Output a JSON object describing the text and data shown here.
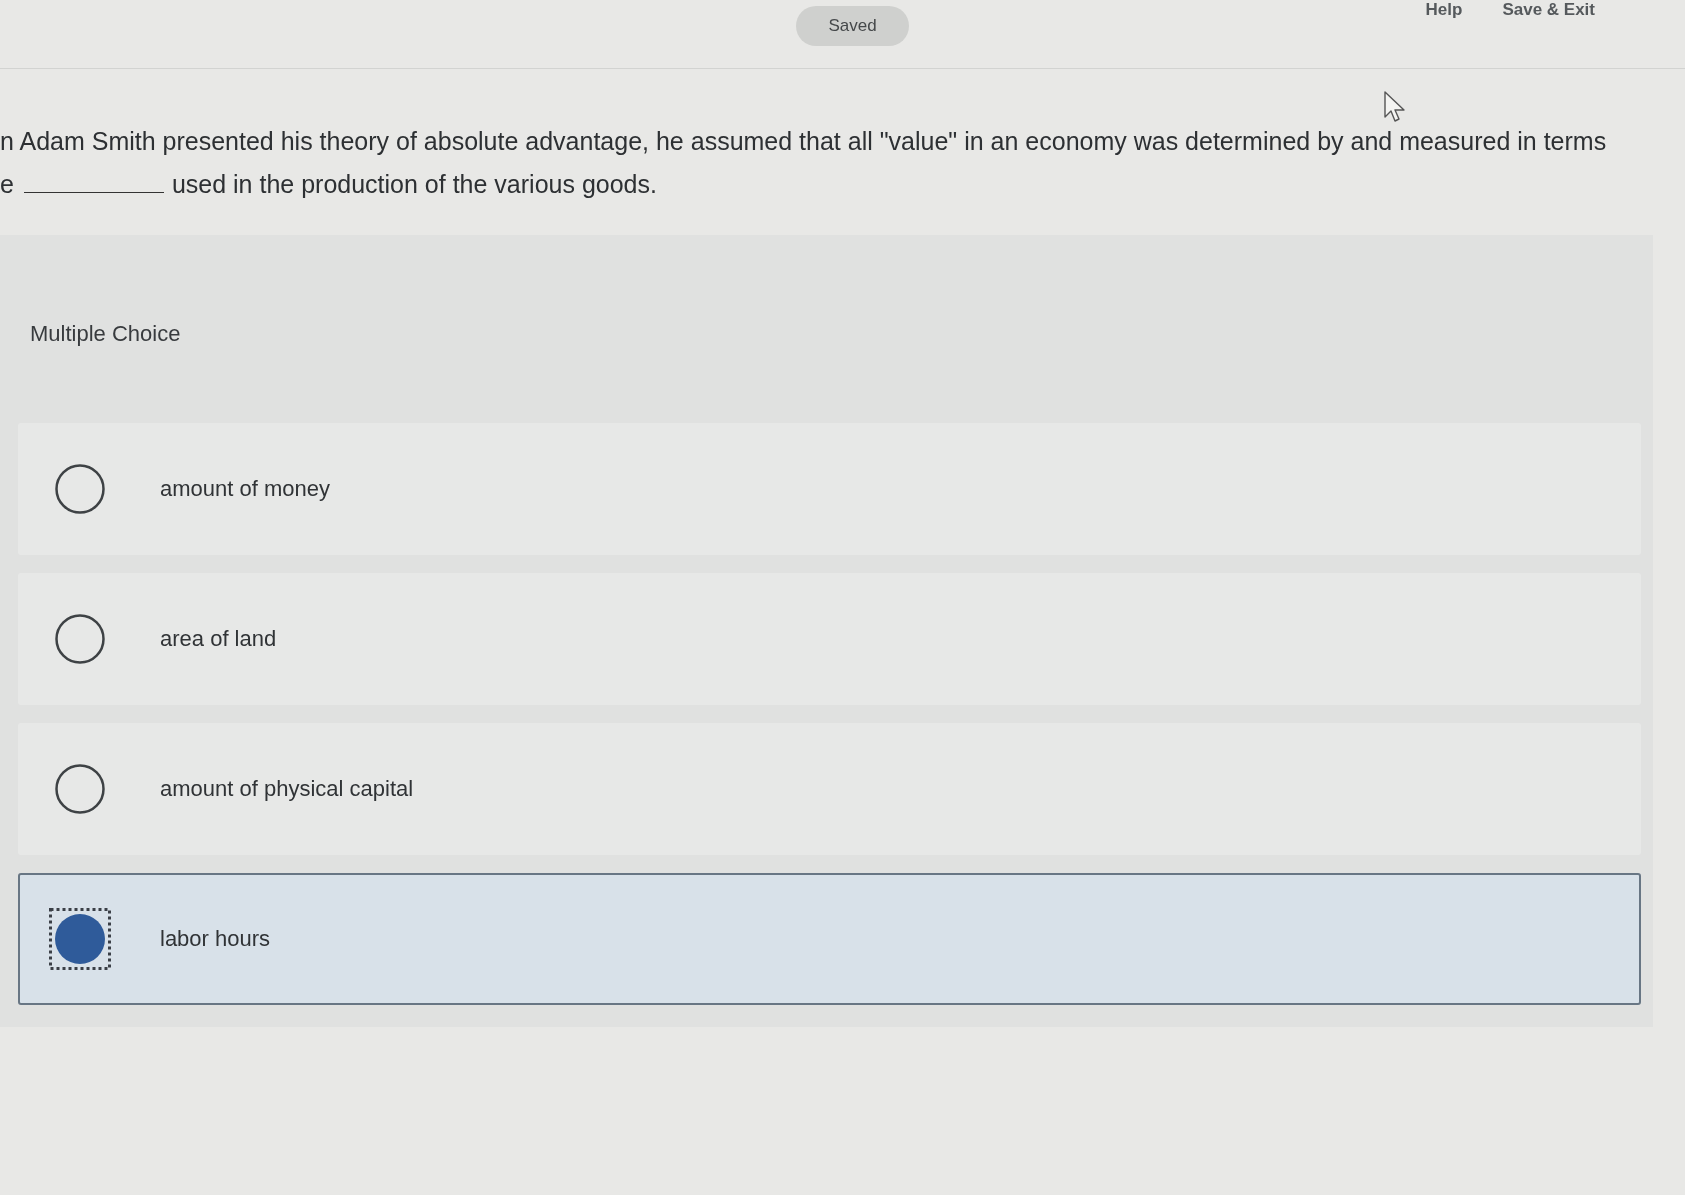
{
  "header": {
    "status_pill": "Saved",
    "links": [
      "Help",
      "Save & Exit"
    ]
  },
  "question": {
    "line_1": "n Adam Smith presented his theory of absolute advantage, he assumed that all \"value\" in an economy was determined by and measured in terms",
    "line_2": {
      "before_blank": "e",
      "after_blank": "used in the production of the various goods."
    }
  },
  "answer_panel": {
    "type_label": "Multiple Choice",
    "options": [
      {
        "label": "amount of money",
        "selected": false
      },
      {
        "label": "area of land",
        "selected": false
      },
      {
        "label": "amount of physical capital",
        "selected": false
      },
      {
        "label": "labor hours",
        "selected": true
      }
    ]
  }
}
